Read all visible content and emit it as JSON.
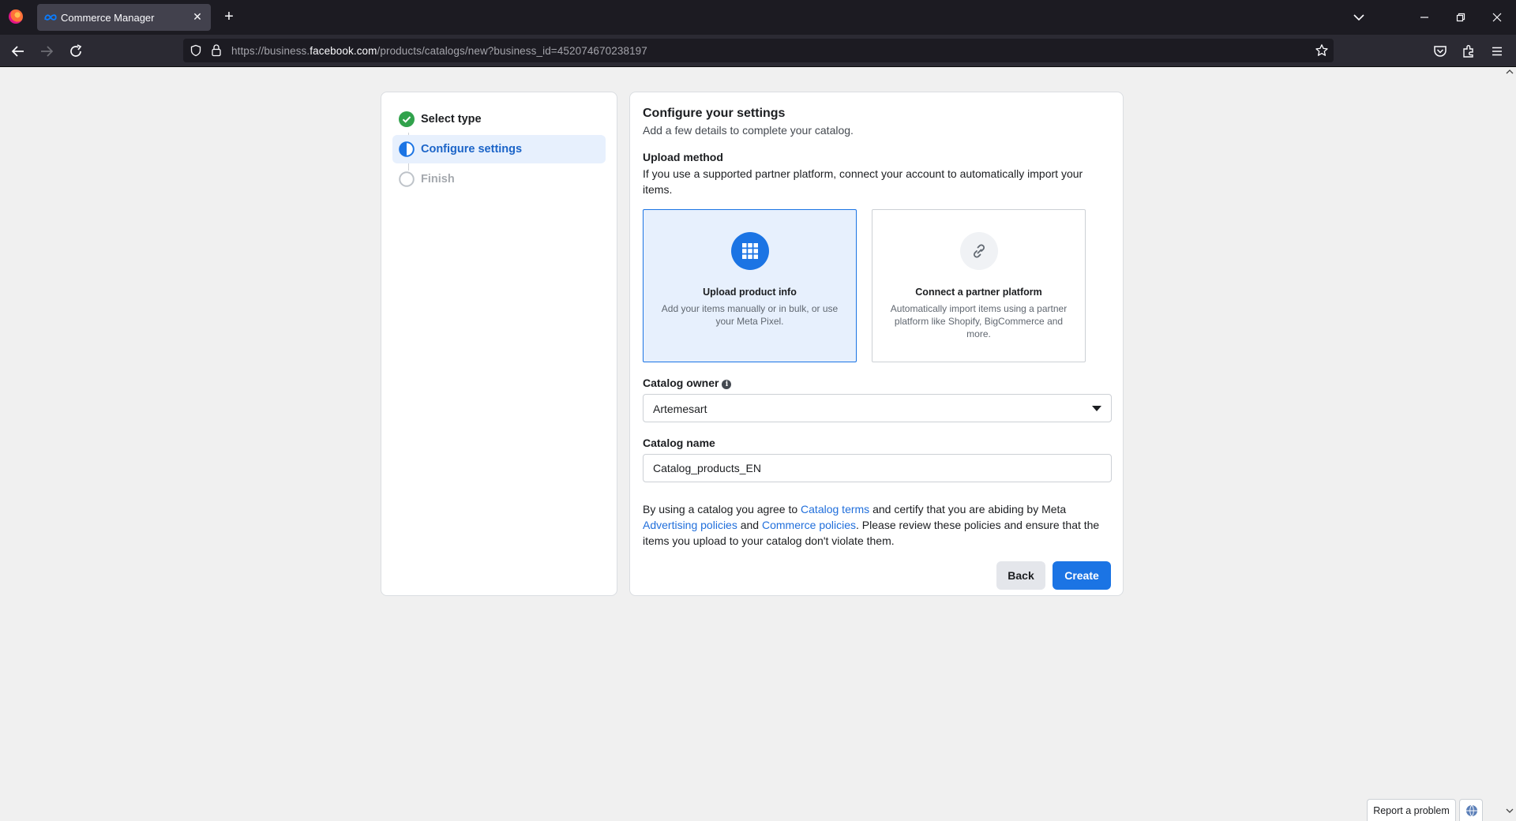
{
  "browser": {
    "tab_title": "Commerce Manager",
    "url_prefix": "https://business.",
    "url_host": "facebook.com",
    "url_path": "/products/catalogs/new?business_id=452074670238197"
  },
  "steps": [
    {
      "label": "Select type",
      "state": "complete"
    },
    {
      "label": "Configure settings",
      "state": "active"
    },
    {
      "label": "Finish",
      "state": "pending"
    }
  ],
  "main": {
    "title": "Configure your settings",
    "subtitle": "Add a few details to complete your catalog.",
    "upload_method": {
      "label": "Upload method",
      "description": "If you use a supported partner platform, connect your account to automatically import your items.",
      "options": [
        {
          "title": "Upload product info",
          "description": "Add your items manually or in bulk, or use your Meta Pixel.",
          "icon": "grid-icon",
          "selected": true
        },
        {
          "title": "Connect a partner platform",
          "description": "Automatically import items using a partner platform like Shopify, BigCommerce and more.",
          "icon": "link-icon",
          "selected": false
        }
      ]
    },
    "catalog_owner": {
      "label": "Catalog owner",
      "value": "Artemesart"
    },
    "catalog_name": {
      "label": "Catalog name",
      "value": "Catalog_products_EN"
    },
    "terms": {
      "t1": "By using a catalog you agree to ",
      "link1": "Catalog terms",
      "t2": " and certify that you are abiding by Meta ",
      "link2": "Advertising policies",
      "t3": " and ",
      "link3": "Commerce policies",
      "t4": ". Please review these policies and ensure that the items you upload to your catalog don't violate them."
    },
    "buttons": {
      "back": "Back",
      "create": "Create"
    }
  },
  "footer": {
    "report_problem": "Report a problem"
  },
  "colors": {
    "accent": "#1b74e4",
    "success": "#31a24c",
    "page_bg": "#f0f0f0"
  }
}
